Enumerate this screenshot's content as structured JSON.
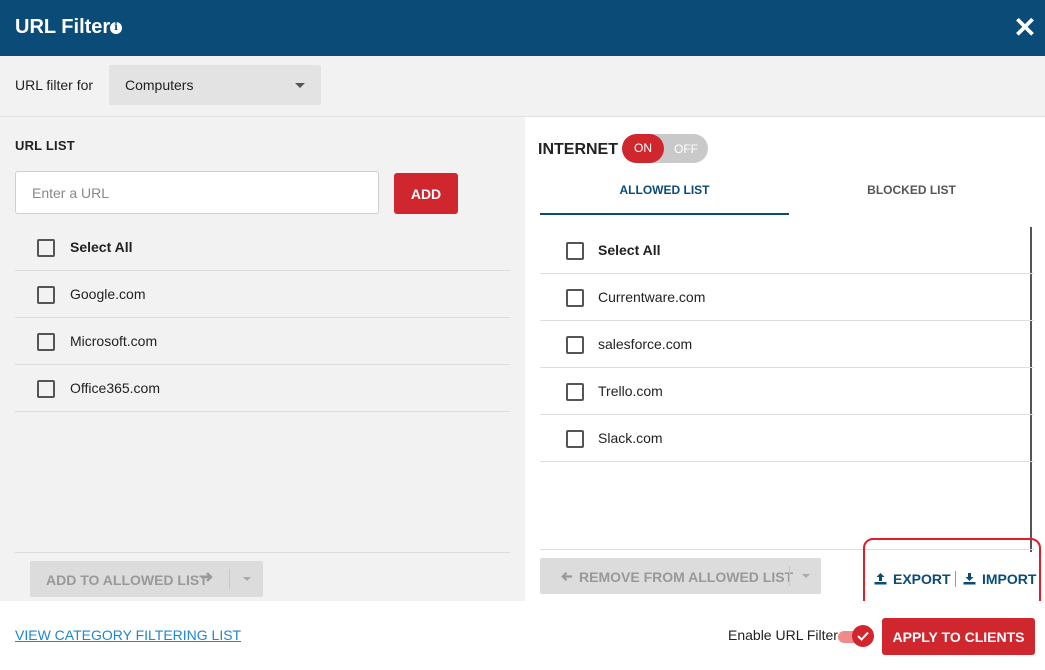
{
  "window": {
    "title": "URL Filter",
    "info_icon": "info-icon",
    "close_icon": "close-icon"
  },
  "filter": {
    "label": "URL filter for",
    "selected": "Computers"
  },
  "url_list": {
    "title": "URL LIST",
    "input_placeholder": "Enter a URL",
    "add_label": "ADD",
    "select_all": "Select All",
    "items": [
      "Google.com",
      "Microsoft.com",
      "Office365.com"
    ],
    "add_to_allowed_label": "ADD TO ALLOWED LIST"
  },
  "internet": {
    "label": "INTERNET",
    "on_label": "ON",
    "off_label": "OFF",
    "state": "on"
  },
  "tabs": {
    "allowed": "ALLOWED LIST",
    "blocked": "BLOCKED LIST",
    "active": "allowed"
  },
  "allowed_list": {
    "select_all": "Select All",
    "items": [
      "Currentware.com",
      "salesforce.com",
      "Trello.com",
      "Slack.com"
    ],
    "remove_label": "REMOVE FROM ALLOWED LIST",
    "export_label": "EXPORT",
    "import_label": "IMPORT"
  },
  "footer": {
    "category_link": "VIEW CATEGORY FILTERING LIST",
    "enable_label": "Enable URL Filter",
    "enable_checked": true,
    "apply_label": "APPLY TO CLIENTS"
  },
  "colors": {
    "header_bg": "#0a4b78",
    "accent_red": "#d0262d",
    "highlight": "#e11d2a",
    "link_blue": "#1f86d3"
  }
}
